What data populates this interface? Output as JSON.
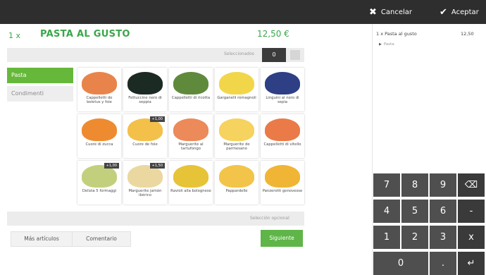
{
  "topbar": {
    "cancel_label": "Cancelar",
    "cancel_icon": "✖",
    "accept_label": "Aceptar",
    "accept_icon": "✔"
  },
  "product": {
    "quantity": "1 x",
    "name": "PASTA AL GUSTO",
    "price": "12,50 €"
  },
  "selection": {
    "label": "Seleccionados",
    "count": "0"
  },
  "categories": [
    {
      "label": "Pasta",
      "active": true
    },
    {
      "label": "Condimenti",
      "active": false
    }
  ],
  "tiles": [
    {
      "label": "Cappelletti de boletus y foie",
      "badge": "",
      "color": "#e8844b"
    },
    {
      "label": "Fettuccine nero di seppia",
      "badge": "",
      "color": "#1c2a24"
    },
    {
      "label": "Cappelletti di ricotta",
      "badge": "",
      "color": "#5f8a3c"
    },
    {
      "label": "Garganelli romagnoli",
      "badge": "",
      "color": "#f2d64a"
    },
    {
      "label": "Linguini al nero di sepia",
      "badge": "",
      "color": "#2e3f86"
    },
    {
      "label": "Cuore di zucca",
      "badge": "",
      "color": "#ee8b30"
    },
    {
      "label": "Cuore de foie",
      "badge": "+1,00",
      "color": "#f3c04a"
    },
    {
      "label": "Marguerite al tartufongo",
      "badge": "",
      "color": "#ec8a5a"
    },
    {
      "label": "Marguerite de parmesano",
      "badge": "",
      "color": "#f6d25e"
    },
    {
      "label": "Cappelletti di vitello",
      "badge": "",
      "color": "#ea7a48"
    },
    {
      "label": "Delizia 5 formaggi",
      "badge": "+1,00",
      "color": "#c2d07d"
    },
    {
      "label": "Marguerite jamón ibérico",
      "badge": "+1,50",
      "color": "#ead8a0"
    },
    {
      "label": "Ravioli alla bolognese",
      "badge": "",
      "color": "#e7c338"
    },
    {
      "label": "Pappardelle",
      "badge": "",
      "color": "#f2c44a"
    },
    {
      "label": "Panzerotti genovesse",
      "badge": "",
      "color": "#f0b535"
    }
  ],
  "optional": {
    "label": "Selección opcional"
  },
  "footer": {
    "more_label": "Más artículos",
    "comment_label": "Comentario",
    "next_label": "Siguiente"
  },
  "order": {
    "line": "1 x Pasta al gusto",
    "price": "12,50",
    "sub": "Pasta"
  },
  "numpad": {
    "keys": [
      "7",
      "8",
      "9",
      "⌫",
      "4",
      "5",
      "6",
      "-",
      "1",
      "2",
      "3",
      "x",
      "0",
      ".",
      "↵"
    ]
  }
}
